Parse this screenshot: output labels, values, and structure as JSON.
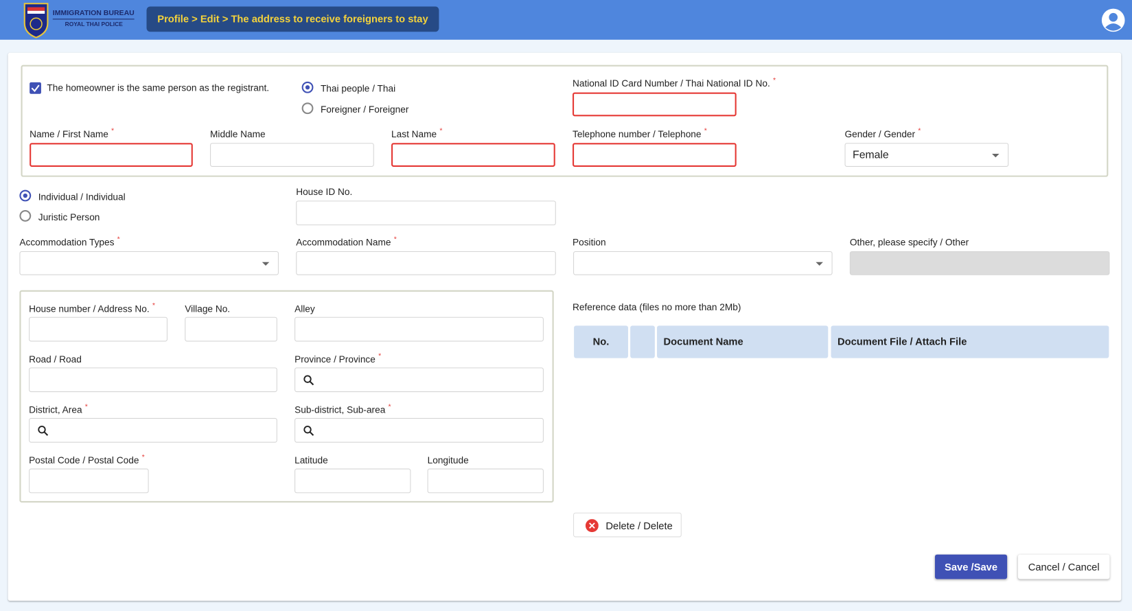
{
  "header": {
    "brand_title": "IMMIGRATION BUREAU",
    "brand_subtitle": "ROYAL THAI POLICE",
    "breadcrumb": "Profile > Edit > The address to receive foreigners to stay",
    "colors": {
      "header": "#4f86dd",
      "breadcrumb_bg": "#264a86",
      "breadcrumb_text": "#f5d33b"
    }
  },
  "owner": {
    "same_person_label": "The homeowner is the same person as the registrant.",
    "same_person_checked": true,
    "nationality_options": [
      {
        "label": "Thai people / Thai",
        "selected": true
      },
      {
        "label": "Foreigner / Foreigner",
        "selected": false
      }
    ],
    "national_id_label": "National ID Card Number / Thai National ID No.",
    "national_id_value": "",
    "first_name_label": "Name / First Name",
    "middle_name_label": "Middle Name",
    "last_name_label": "Last Name",
    "telephone_label": "Telephone number / Telephone",
    "gender_label": "Gender / Gender",
    "gender_value": "Female"
  },
  "person_type": {
    "options": [
      {
        "label": "Individual / Individual",
        "selected": true
      },
      {
        "label": "Juristic Person",
        "selected": false
      }
    ],
    "house_id_label": "House ID No."
  },
  "accommodation": {
    "types_label": "Accommodation Types",
    "name_label": "Accommodation Name",
    "position_label": "Position",
    "other_label": "Other, please specify / Other"
  },
  "address": {
    "house_number_label": "House number / Address No.",
    "village_label": "Village No.",
    "alley_label": "Alley",
    "road_label": "Road / Road",
    "province_label": "Province / Province",
    "district_label": "District, Area",
    "subdistrict_label": "Sub-district, Sub-area",
    "postal_label": "Postal Code / Postal Code",
    "latitude_label": "Latitude",
    "longitude_label": "Longitude"
  },
  "reference": {
    "label": "Reference data (files no more than 2Mb)",
    "columns": [
      "No.",
      "",
      "Document Name",
      "Document File / Attach File"
    ],
    "rows": []
  },
  "actions": {
    "delete": "Delete / Delete",
    "save": "Save /Save",
    "cancel": "Cancel / Cancel",
    "accent": "#3f51b5"
  }
}
